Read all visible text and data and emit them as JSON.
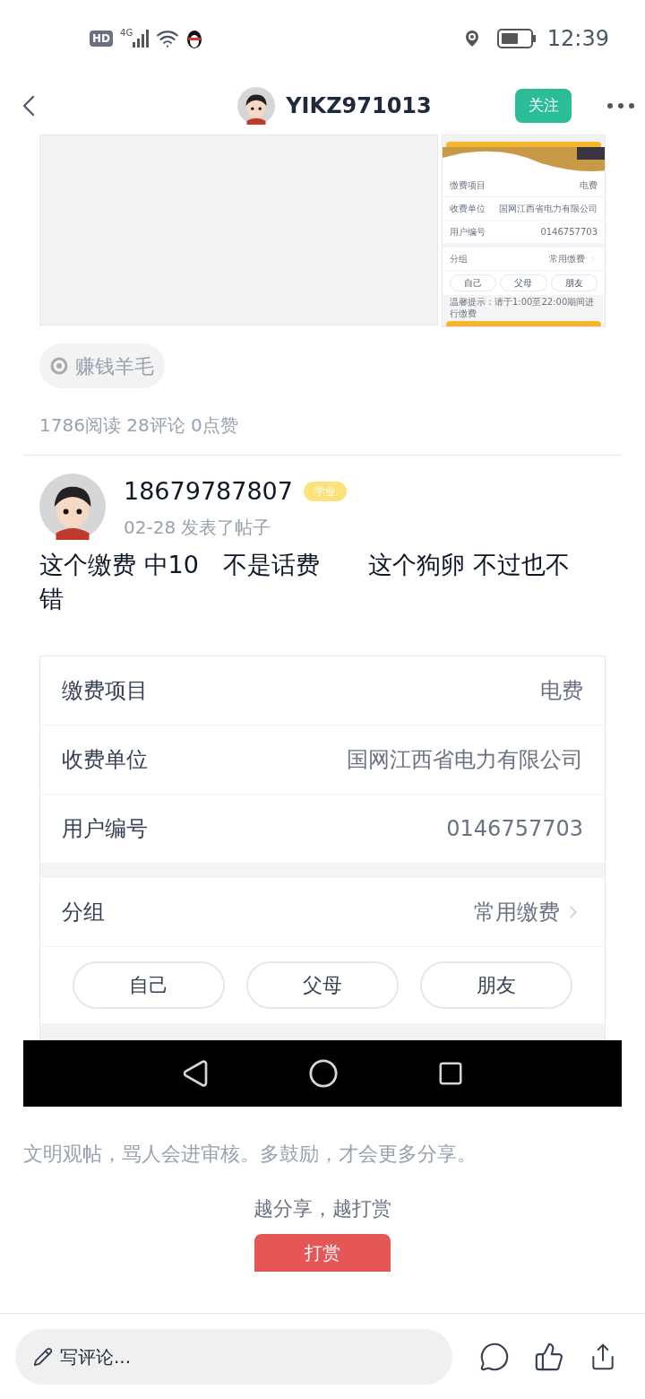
{
  "status_bar": {
    "hd": "HD",
    "network": "4G",
    "time": "12:39"
  },
  "header": {
    "username": "YIKZ971013",
    "follow": "关注"
  },
  "thumbnail": {
    "rows": [
      {
        "label": "缴费项目",
        "value": "电费"
      },
      {
        "label": "收费单位",
        "value": "国网江西省电力有限公司"
      },
      {
        "label": "用户编号",
        "value": "0146757703"
      }
    ],
    "group": {
      "label": "分组",
      "value": "常用缴费"
    },
    "options": [
      "自己",
      "父母",
      "朋友"
    ],
    "hint": "温馨提示：请于1:00至22:00期间进行缴费"
  },
  "tag": "赚钱羊毛",
  "stats": "1786阅读 28评论 0点赞",
  "post": {
    "author": "18679787807",
    "badge": "学业",
    "meta": "02-28 发表了帖子",
    "text": "这个缴费 中10　不是话费　　这个狗卵 不过也不错"
  },
  "screenshot": {
    "rows": [
      {
        "label": "缴费项目",
        "value": "电费"
      },
      {
        "label": "收费单位",
        "value": "国网江西省电力有限公司"
      },
      {
        "label": "用户编号",
        "value": "0146757703"
      }
    ],
    "group": {
      "label": "分组",
      "value": "常用缴费"
    },
    "options": [
      "自己",
      "父母",
      "朋友"
    ]
  },
  "notice": "文明观帖，骂人会进审核。多鼓励，才会更多分享。",
  "reward_slogan": "越分享，越打赏",
  "reward_button": "打赏",
  "comment": {
    "placeholder": "写评论..."
  }
}
